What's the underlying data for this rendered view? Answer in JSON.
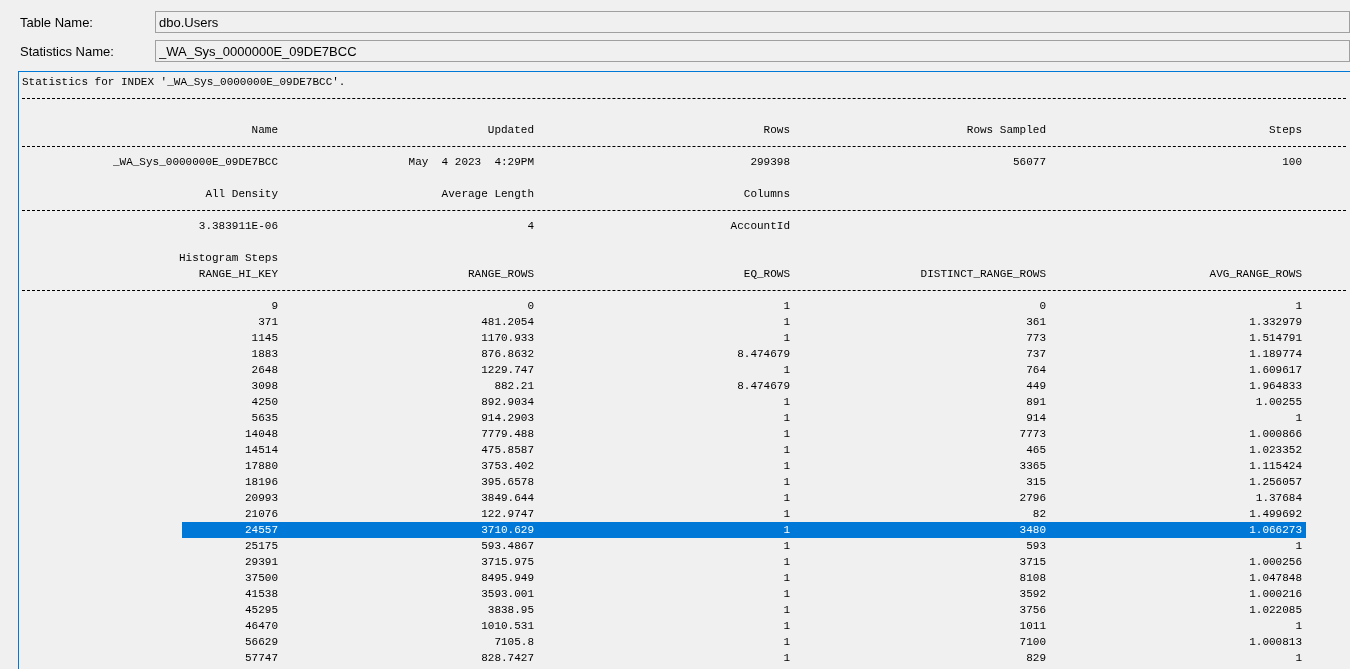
{
  "fields": [
    {
      "label": "Table Name:",
      "value": "dbo.Users"
    },
    {
      "label": "Statistics Name:",
      "value": "_WA_Sys_0000000E_09DE7BCC"
    }
  ],
  "output": {
    "title_line": "Statistics for INDEX '_WA_Sys_0000000E_09DE7BCC'.",
    "header": {
      "columns": [
        "Name",
        "Updated",
        "Rows",
        "Rows Sampled",
        "Steps"
      ],
      "values": [
        "_WA_Sys_0000000E_09DE7BCC",
        "May  4 2023  4:29PM",
        "299398",
        "56077",
        "100"
      ]
    },
    "density": {
      "columns": [
        "All Density",
        "Average Length",
        "Columns"
      ],
      "values": [
        "3.383911E-06",
        "4",
        "AccountId"
      ]
    },
    "histogram": {
      "caption": "Histogram Steps",
      "columns": [
        "RANGE_HI_KEY",
        "RANGE_ROWS",
        "EQ_ROWS",
        "DISTINCT_RANGE_ROWS",
        "AVG_RANGE_ROWS"
      ],
      "rows": [
        {
          "cells": [
            "9",
            "0",
            "1",
            "0",
            "1"
          ],
          "selected": false
        },
        {
          "cells": [
            "371",
            "481.2054",
            "1",
            "361",
            "1.332979"
          ],
          "selected": false
        },
        {
          "cells": [
            "1145",
            "1170.933",
            "1",
            "773",
            "1.514791"
          ],
          "selected": false
        },
        {
          "cells": [
            "1883",
            "876.8632",
            "8.474679",
            "737",
            "1.189774"
          ],
          "selected": false
        },
        {
          "cells": [
            "2648",
            "1229.747",
            "1",
            "764",
            "1.609617"
          ],
          "selected": false
        },
        {
          "cells": [
            "3098",
            "882.21",
            "8.474679",
            "449",
            "1.964833"
          ],
          "selected": false
        },
        {
          "cells": [
            "4250",
            "892.9034",
            "1",
            "891",
            "1.00255"
          ],
          "selected": false
        },
        {
          "cells": [
            "5635",
            "914.2903",
            "1",
            "914",
            "1"
          ],
          "selected": false
        },
        {
          "cells": [
            "14048",
            "7779.488",
            "1",
            "7773",
            "1.000866"
          ],
          "selected": false
        },
        {
          "cells": [
            "14514",
            "475.8587",
            "1",
            "465",
            "1.023352"
          ],
          "selected": false
        },
        {
          "cells": [
            "17880",
            "3753.402",
            "1",
            "3365",
            "1.115424"
          ],
          "selected": false
        },
        {
          "cells": [
            "18196",
            "395.6578",
            "1",
            "315",
            "1.256057"
          ],
          "selected": false
        },
        {
          "cells": [
            "20993",
            "3849.644",
            "1",
            "2796",
            "1.37684"
          ],
          "selected": false
        },
        {
          "cells": [
            "21076",
            "122.9747",
            "1",
            "82",
            "1.499692"
          ],
          "selected": false
        },
        {
          "cells": [
            "24557",
            "3710.629",
            "1",
            "3480",
            "1.066273"
          ],
          "selected": true
        },
        {
          "cells": [
            "25175",
            "593.4867",
            "1",
            "593",
            "1"
          ],
          "selected": false
        },
        {
          "cells": [
            "29391",
            "3715.975",
            "1",
            "3715",
            "1.000256"
          ],
          "selected": false
        },
        {
          "cells": [
            "37500",
            "8495.949",
            "1",
            "8108",
            "1.047848"
          ],
          "selected": false
        },
        {
          "cells": [
            "41538",
            "3593.001",
            "1",
            "3592",
            "1.000216"
          ],
          "selected": false
        },
        {
          "cells": [
            "45295",
            "3838.95",
            "1",
            "3756",
            "1.022085"
          ],
          "selected": false
        },
        {
          "cells": [
            "46470",
            "1010.531",
            "1",
            "1011",
            "1"
          ],
          "selected": false
        },
        {
          "cells": [
            "56629",
            "7105.8",
            "1",
            "7100",
            "1.000813"
          ],
          "selected": false
        },
        {
          "cells": [
            "57747",
            "828.7427",
            "1",
            "829",
            "1"
          ],
          "selected": false
        }
      ]
    }
  }
}
